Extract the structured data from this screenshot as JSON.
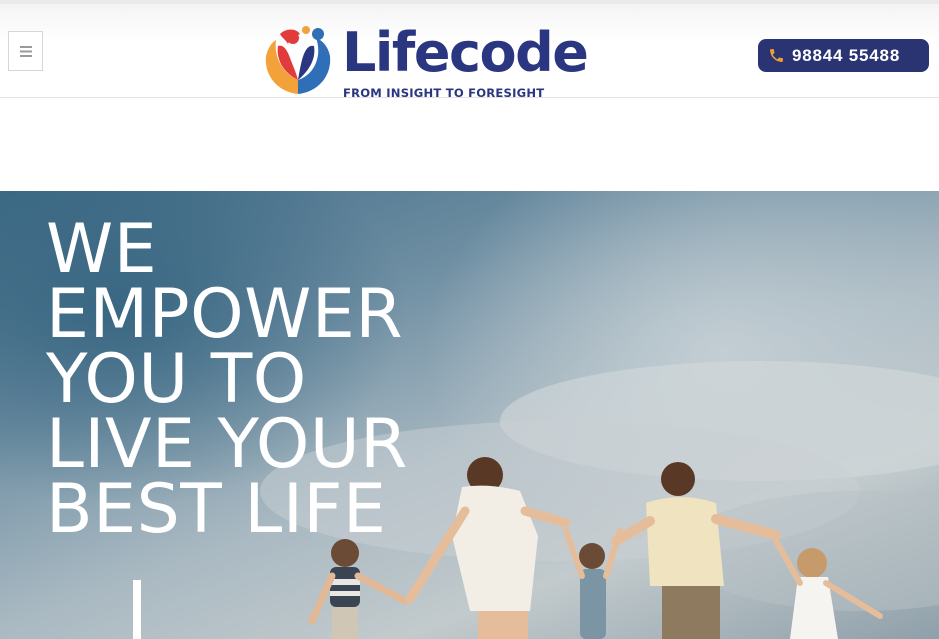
{
  "header": {
    "menu_icon": "hamburger-menu-icon",
    "logo": {
      "name": "Lifecode",
      "tagline": "FROM INSIGHT TO FORESIGHT"
    },
    "phone": {
      "icon": "phone-icon",
      "number": "98844 55488"
    }
  },
  "hero": {
    "title_lines": [
      "WE",
      "EMPOWER",
      "YOU TO",
      "LIVE YOUR",
      "BEST LIFE"
    ]
  },
  "colors": {
    "brand_navy": "#2b3680",
    "phone_button": "#2a3473",
    "phone_icon": "#f0a030"
  }
}
